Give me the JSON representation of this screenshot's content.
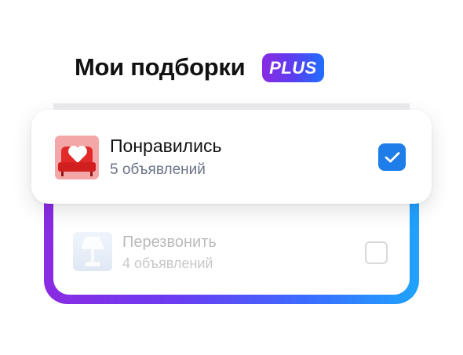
{
  "header": {
    "title": "Мои подборки",
    "badge": "PLUS"
  },
  "collections": [
    {
      "name": "Понравились",
      "count": "5 объявлений",
      "checked": true,
      "icon": "red-sofa-heart-thumbnail"
    },
    {
      "name": "Перезвонить",
      "count": "4 объявлений",
      "checked": false,
      "icon": "lamp-thumbnail"
    }
  ],
  "colors": {
    "accent_blue": "#1e7de8",
    "gradient_start": "#8a2be2",
    "gradient_end": "#1fa3ff"
  }
}
